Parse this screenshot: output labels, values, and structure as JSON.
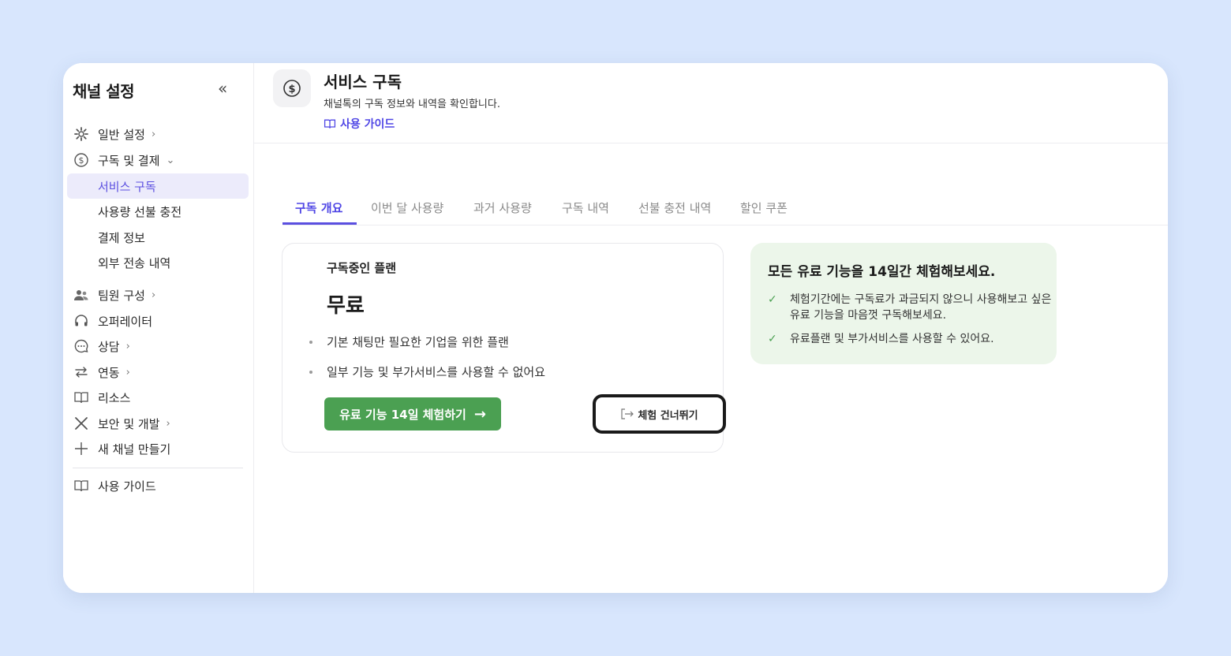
{
  "sidebar": {
    "title": "채널 설정",
    "collapse_label": "«",
    "items": {
      "general": {
        "label": "일반 설정",
        "chevron": "›"
      },
      "billing": {
        "label": "구독 및 결제",
        "chevron": "⌄"
      },
      "team": {
        "label": "팀원 구성",
        "chevron": "›"
      },
      "operator": {
        "label": "오퍼레이터"
      },
      "consult": {
        "label": "상담",
        "chevron": "›"
      },
      "integration": {
        "label": "연동",
        "chevron": "›"
      },
      "resources": {
        "label": "리소스"
      },
      "security": {
        "label": "보안 및 개발",
        "chevron": "›"
      },
      "new_channel": {
        "label": "새 채널 만들기"
      },
      "guide": {
        "label": "사용 가이드"
      }
    },
    "billing_sub": [
      {
        "label": "서비스 구독",
        "active": true
      },
      {
        "label": "사용량 선불 충전"
      },
      {
        "label": "결제 정보"
      },
      {
        "label": "외부 전송 내역"
      }
    ]
  },
  "header": {
    "title": "서비스 구독",
    "description": "채널톡의 구독 정보와 내역을 확인합니다.",
    "guide_link": "사용 가이드"
  },
  "tabs": [
    {
      "label": "구독 개요",
      "active": true
    },
    {
      "label": "이번 달 사용량"
    },
    {
      "label": "과거 사용량"
    },
    {
      "label": "구독 내역"
    },
    {
      "label": "선불 충전 내역"
    },
    {
      "label": "할인 쿠폰"
    }
  ],
  "plan": {
    "label": "구독중인 플랜",
    "name": "무료",
    "features": [
      "기본 채팅만 필요한 기업을 위한 플랜",
      "일부 기능 및 부가서비스를 사용할 수 없어요"
    ],
    "trial_button": "유료 기능 14일 체험하기",
    "trial_arrow": "→",
    "skip_button": "체험 건너뛰기"
  },
  "promo": {
    "title": "모든 유료 기능을 14일간 체험해보세요.",
    "check_glyph": "✓",
    "items": [
      "체험기간에는 구독료가 과금되지 않으니 사용해보고 싶은 유료 기능을 마음껏 구독해보세요.",
      "유료플랜 및 부가서비스를 사용할 수 있어요."
    ]
  },
  "colors": {
    "background": "#d8e6fd",
    "accent": "#5b4fe0",
    "active_bg": "#ecebfb",
    "trial_green": "#4ba052",
    "promo_bg": "#ecf6ea"
  },
  "icons": {
    "general": "gear-icon",
    "billing": "dollar-circle-icon",
    "team": "people-icon",
    "operator": "headset-icon",
    "consult": "chat-bubble-icon",
    "integration": "arrows-exchange-icon",
    "resources": "book-icon",
    "security": "tools-icon",
    "new_channel": "plus-icon",
    "guide": "book-icon",
    "header": "dollar-circle-icon",
    "skip": "exit-icon"
  }
}
